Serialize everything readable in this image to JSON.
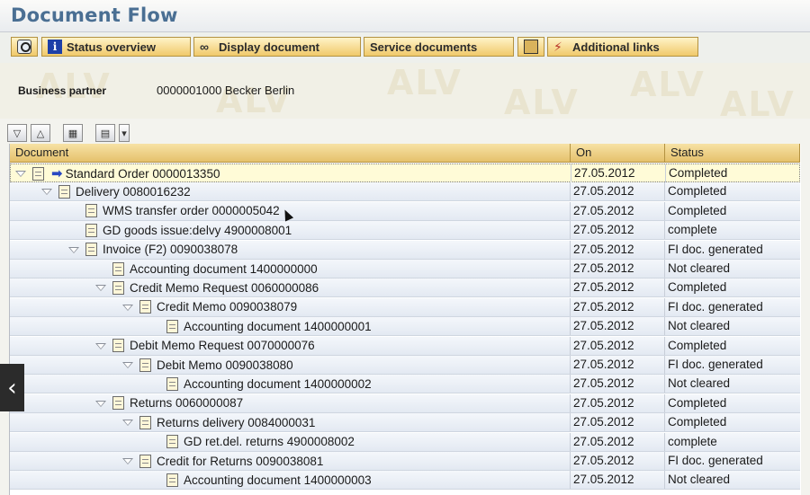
{
  "window": {
    "title": "Document Flow"
  },
  "toolbar": {
    "buttons": [
      {
        "label": "",
        "icon": "find-icon"
      },
      {
        "label": "Status overview",
        "icon": "info-icon"
      },
      {
        "label": "Display document",
        "icon": "glasses-icon"
      },
      {
        "label": "Service documents",
        "icon": ""
      },
      {
        "label": "",
        "icon": "books-icon"
      },
      {
        "label": "Additional links",
        "icon": "link-icon"
      }
    ]
  },
  "header": {
    "business_partner_label": "Business partner",
    "business_partner_value": "0000001000 Becker Berlin",
    "watermark": "ALV"
  },
  "tree_toolbar": {
    "icons": [
      "expand-all-icon",
      "collapse-all-icon",
      "find-icon",
      "print-icon",
      "dropdown-icon"
    ]
  },
  "grid": {
    "columns": [
      "Document",
      "On",
      "Status"
    ],
    "rows": [
      {
        "level": 0,
        "toggle": true,
        "arrow": true,
        "document": "Standard Order 0000013350",
        "on": "27.05.2012",
        "status": "Completed",
        "selected": true
      },
      {
        "level": 1,
        "toggle": true,
        "document": "Delivery 0080016232",
        "on": "27.05.2012",
        "status": "Completed"
      },
      {
        "level": 2,
        "toggle": false,
        "document": "WMS transfer order 0000005042",
        "on": "27.05.2012",
        "status": "Completed"
      },
      {
        "level": 2,
        "toggle": false,
        "document": "GD goods issue:delvy 4900008001",
        "on": "27.05.2012",
        "status": "complete"
      },
      {
        "level": 2,
        "toggle": true,
        "document": "Invoice (F2) 0090038078",
        "on": "27.05.2012",
        "status": "FI doc. generated"
      },
      {
        "level": 3,
        "toggle": false,
        "document": "Accounting document 1400000000",
        "on": "27.05.2012",
        "status": "Not cleared"
      },
      {
        "level": 3,
        "toggle": true,
        "document": "Credit Memo Request 0060000086",
        "on": "27.05.2012",
        "status": "Completed"
      },
      {
        "level": 4,
        "toggle": true,
        "document": "Credit Memo 0090038079",
        "on": "27.05.2012",
        "status": "FI doc. generated"
      },
      {
        "level": 5,
        "toggle": false,
        "document": "Accounting document 1400000001",
        "on": "27.05.2012",
        "status": "Not cleared"
      },
      {
        "level": 3,
        "toggle": true,
        "document": "Debit Memo Request 0070000076",
        "on": "27.05.2012",
        "status": "Completed"
      },
      {
        "level": 4,
        "toggle": true,
        "document": "Debit Memo 0090038080",
        "on": "27.05.2012",
        "status": "FI doc. generated"
      },
      {
        "level": 5,
        "toggle": false,
        "document": "Accounting document 1400000002",
        "on": "27.05.2012",
        "status": "Not cleared"
      },
      {
        "level": 3,
        "toggle": true,
        "document": "Returns 0060000087",
        "on": "27.05.2012",
        "status": "Completed"
      },
      {
        "level": 4,
        "toggle": true,
        "document": "Returns delivery 0084000031",
        "on": "27.05.2012",
        "status": "Completed"
      },
      {
        "level": 5,
        "toggle": false,
        "document": "GD ret.del. returns 4900008002",
        "on": "27.05.2012",
        "status": "complete"
      },
      {
        "level": 4,
        "toggle": true,
        "document": "Credit for Returns 0090038081",
        "on": "27.05.2012",
        "status": "FI doc. generated"
      },
      {
        "level": 5,
        "toggle": false,
        "document": "Accounting document 1400000003",
        "on": "27.05.2012",
        "status": "Not cleared"
      }
    ]
  },
  "side_nav": {
    "label": "‹",
    "icon": "chevron-left-icon"
  }
}
